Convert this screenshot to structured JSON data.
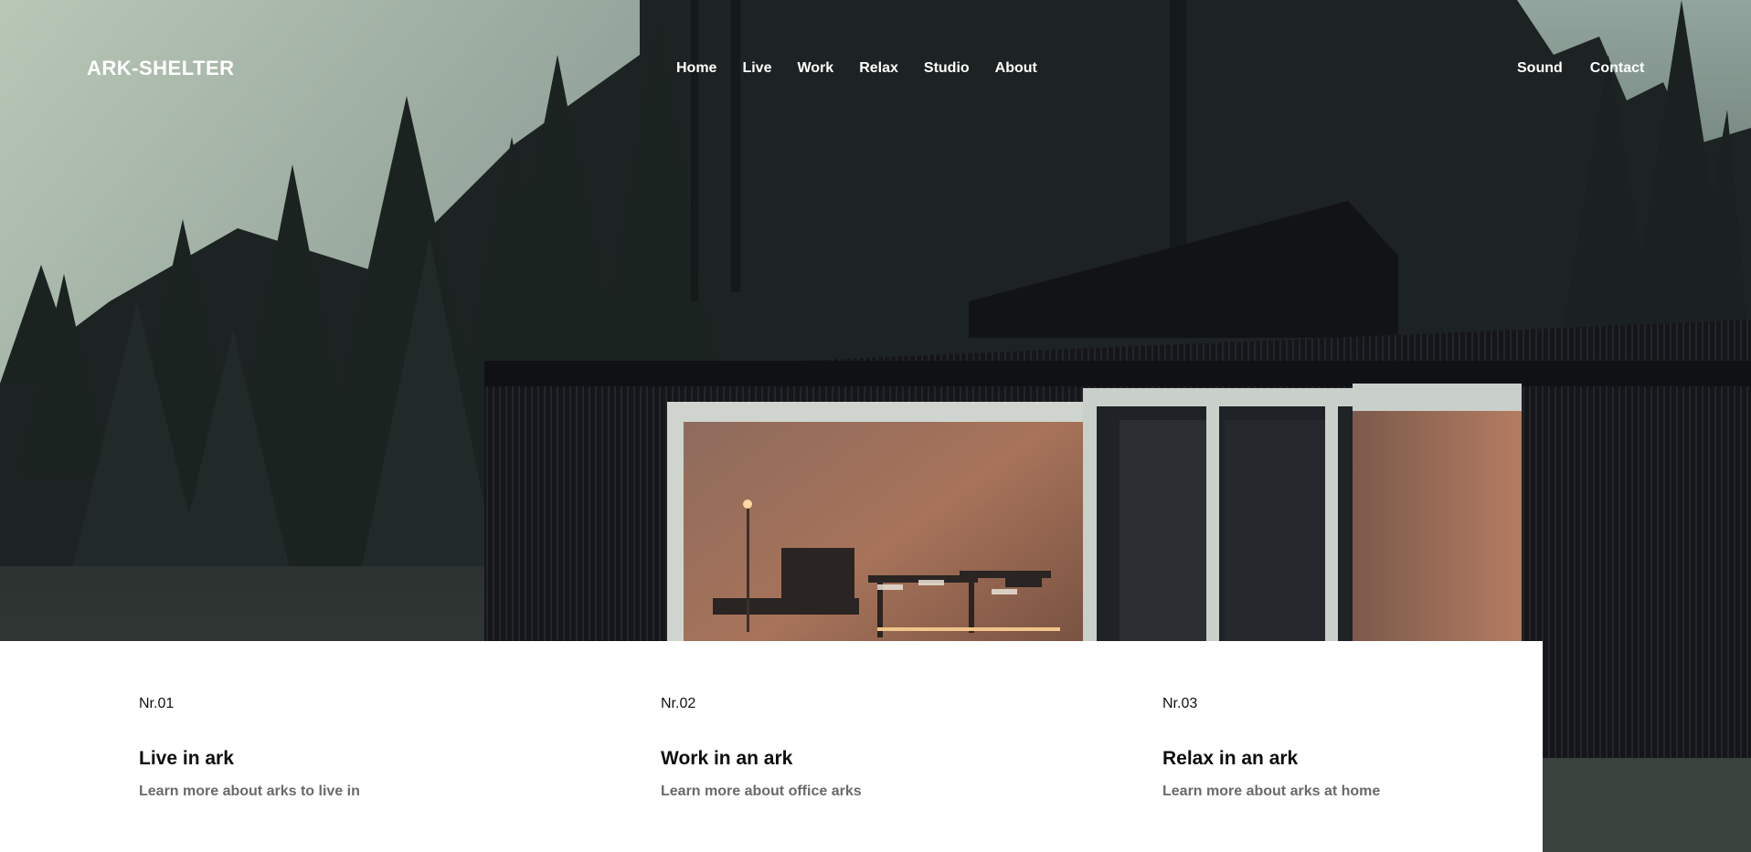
{
  "brand": {
    "name": "ARK-SHELTER"
  },
  "nav": {
    "main": [
      {
        "label": "Home"
      },
      {
        "label": "Live"
      },
      {
        "label": "Work"
      },
      {
        "label": "Relax"
      },
      {
        "label": "Studio"
      },
      {
        "label": "About"
      }
    ],
    "utility": [
      {
        "label": "Sound"
      },
      {
        "label": "Contact"
      }
    ]
  },
  "hero": {
    "image": "forest-cabin-at-dusk",
    "colors": {
      "sky": "#aebdb0",
      "forest": "#1a2221",
      "cabin": "#17181c",
      "interior_glow": "#a4725a"
    }
  },
  "features": [
    {
      "number": "Nr.01",
      "title": "Live in ark",
      "description": "Learn more about arks to live in"
    },
    {
      "number": "Nr.02",
      "title": "Work in an ark",
      "description": "Learn more about office arks"
    },
    {
      "number": "Nr.03",
      "title": "Relax in an ark",
      "description": "Learn more about arks at home"
    }
  ]
}
